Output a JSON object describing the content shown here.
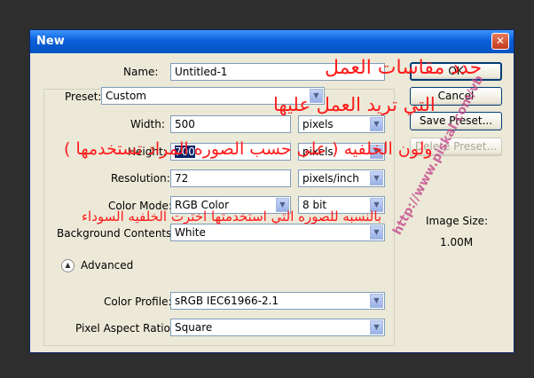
{
  "window": {
    "title": "New",
    "close_glyph": "✕"
  },
  "form": {
    "name": {
      "label": "Name:",
      "value": "Untitled-1"
    },
    "preset": {
      "label": "Preset:",
      "value": "Custom"
    },
    "width": {
      "label": "Width:",
      "value": "500",
      "unit": "pixels"
    },
    "height": {
      "label": "Height:",
      "value": "700",
      "unit": "pixels"
    },
    "resolution": {
      "label": "Resolution:",
      "value": "72",
      "unit": "pixels/inch"
    },
    "color_mode": {
      "label": "Color Mode:",
      "value": "RGB Color",
      "depth": "8 bit"
    },
    "background_contents": {
      "label": "Background Contents:",
      "value": "White"
    },
    "advanced_label": "Advanced",
    "color_profile": {
      "label": "Color Profile:",
      "value": "sRGB IEC61966-2.1"
    },
    "pixel_aspect_ratio": {
      "label": "Pixel Aspect Ratio:",
      "value": "Square"
    }
  },
  "buttons": {
    "ok": "OK",
    "cancel": "Cancel",
    "save_preset": "Save Preset...",
    "delete_preset": "Delete Preset..."
  },
  "image_size": {
    "label": "Image Size:",
    "value": "1.00M"
  },
  "annotations": [
    "حدد مقاسات العمل",
    "التي تريد العمل عليها",
    "ولون الخلفيه  ( على حسب الصوره المراد تستخدمها )",
    "بالنسبه للصوره التي استخدمتها اخترت الخلفيه السوداء"
  ],
  "watermark": "http://www.piskal.com/vb",
  "colors": {
    "titlebar": "#0a5fd8",
    "dialog_bg": "#ece9d8",
    "annotation": "#ff1a1a"
  }
}
